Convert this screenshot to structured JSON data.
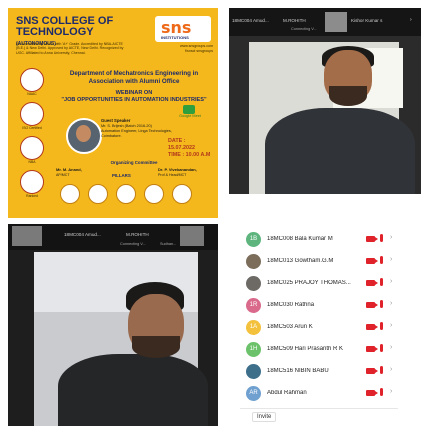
{
  "poster": {
    "college": "SNS COLLEGE OF TECHNOLOGY",
    "college_sub": "(AUTONOMOUS)",
    "accreditation": "An Accredited by NAAC with 'A+' Grade. Accredited by NBA-AICTE (B.E.) & New Delhi. Approved by AICTE, New Delhi. Recognized by UGC. Affiliated to Anna University, Chennai.",
    "logo_text": "sns",
    "logo_sub": "INSTITUTIONS",
    "website": "www.snsgroups.com",
    "social": "f/snsct snsgroups",
    "department": "Department of Mechatronics Engineering in Association with Alumni Office",
    "webinar_label": "WEBINAR ON",
    "webinar_title": "\"JOB OPPORTUNITIES IN AUTOMATION INDUSTRIES\"",
    "guest_label": "Guest Speaker",
    "speaker_name": "Mr. S. Brijesh (Batch 2016-20)",
    "speaker_role": "Automation Engineer, Linga Technologies, Coimbatore.",
    "platform": "Google Meet",
    "date": "DATE : 15.07.2022",
    "time": "TIME : 10.00 A.M",
    "organizing": "Organizing Committee",
    "coord_left_name": "Mr. M. Anand,",
    "coord_left_role": "AP/MCT",
    "coord_right_name": "Dr. P. Vivekanandan,",
    "coord_right_role": "Prof & Head/MCT",
    "pillars": "PILLARS",
    "left_badges": [
      "NAAC",
      "ISO Certified",
      "NBA",
      "Ranked"
    ]
  },
  "video_top": {
    "tile1_label": "18MC004 Amud...",
    "tile2_label": "M.ROHITH",
    "tile3_label": "Kishor Kumar s",
    "more": "›",
    "status": "Connecting V..."
  },
  "video_bottom": {
    "tile1_label": "18MC004 Amud...",
    "tile2_label": "M.ROHITH",
    "status": "Connecting V...",
    "status2": "Sudhan..."
  },
  "participants": {
    "items": [
      {
        "initials": "1B",
        "name": "18MC008 Bala Kumar M",
        "color": "#5db57d"
      },
      {
        "initials": "",
        "name": "18MC013 Gowtham.G.M",
        "color": "#7b6d5a"
      },
      {
        "initials": "",
        "name": "18MC025 PRAJOY THOMAS...",
        "color": "#6d6a66"
      },
      {
        "initials": "1R",
        "name": "18MC030 Rathna",
        "color": "#d96a8c"
      },
      {
        "initials": "1A",
        "name": "18MC503 Arun K",
        "color": "#f3c13c"
      },
      {
        "initials": "1H",
        "name": "18MC509 Hari Prasanth  R K",
        "color": "#6cc26a"
      },
      {
        "initials": "",
        "name": "18MC516 NIBIN BABU",
        "color": "#3e6f8a"
      },
      {
        "initials": "AR",
        "name": "Abdul Rahman",
        "color": "#6fa0cf"
      }
    ],
    "invite_label": "Invite"
  }
}
